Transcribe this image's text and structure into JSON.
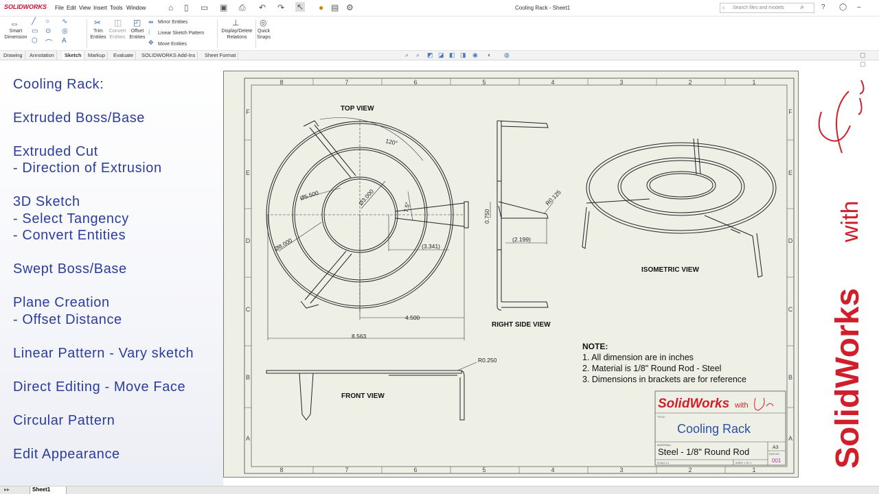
{
  "app": {
    "brand": "SOLIDWORKS",
    "window_title": "Cooling Rack - Sheet1"
  },
  "menu": [
    "File",
    "Edit",
    "View",
    "Insert",
    "Tools",
    "Window"
  ],
  "search": {
    "placeholder": "Search files and models"
  },
  "ribbon": {
    "smart_dimension": "Smart\nDimension",
    "trim_entities": "Trim\nEntities",
    "convert_entities": "Convert\nEntities",
    "offset_entities": "Offset\nEntities",
    "mirror_entities": "Mirror Entities",
    "linear_sketch_pattern": "Linear Sketch Pattern",
    "move_entities": "Move Entities",
    "display_delete_relations": "Display/Delete\nRelations",
    "quick_snaps": "Quick\nSnaps"
  },
  "tabs": [
    "Drawing",
    "Annotation",
    "Sketch",
    "Markup",
    "Evaluate",
    "SOLIDWORKS Add-Ins",
    "Sheet Format"
  ],
  "active_tab": "Sketch",
  "features": [
    "Cooling Rack:",
    "Extruded Boss/Base",
    "Extruded Cut",
    "- Direction of Extrusion",
    "3D Sketch",
    "- Select Tangency",
    "- Convert Entities",
    "Swept Boss/Base",
    "Plane Creation",
    "- Offset Distance",
    "Linear Pattern - Vary sketch",
    "Direct Editing - Move Face",
    "Circular Pattern",
    "Edit Appearance"
  ],
  "drawing": {
    "zone_cols": [
      "8",
      "7",
      "6",
      "5",
      "4",
      "3",
      "2",
      "1"
    ],
    "zone_rows": [
      "F",
      "E",
      "D",
      "C",
      "B",
      "A"
    ],
    "views": {
      "top": "TOP VIEW",
      "right": "RIGHT SIDE VIEW",
      "front": "FRONT VIEW",
      "iso": "ISOMETRIC VIEW"
    },
    "dims": {
      "angle": "120°",
      "d_5500": "Ø5.500",
      "d_3000": "Ø3.000",
      "d_8000": "Ø8.000",
      "ang75": "7.5°",
      "ref_3341": "(3.341)",
      "dim_4500": "4.500",
      "dim_8563": "8.563",
      "dim_0750": "0.750",
      "r_0125": "R0.125",
      "ref_2199": "(2.199)",
      "r_0250": "R0.250"
    },
    "note": {
      "title": "NOTE:",
      "lines": [
        "1. All dimension are in inches",
        "2. Material is 1/8\" Round Rod - Steel",
        "3. Dimensions in brackets are for reference"
      ]
    },
    "title_block": {
      "logo_main": "SolidWorks",
      "logo_with": "with",
      "title_label": "TITLE:",
      "title": "Cooling Rack",
      "material_label": "MATERIAL:",
      "material": "Steel - 1/8\" Round Rod",
      "size": "A3",
      "dwg_label": "DWG NO.",
      "dwg_no": "001",
      "scale": "SCALE:1:2",
      "sheet": "SHEET 1 OF 1"
    }
  },
  "branding": {
    "main": "SolidWorks",
    "with": "with"
  },
  "sheet_tab": "Sheet1",
  "colors": {
    "feature_text": "#2b3d9c",
    "brand_red": "#d01f2a",
    "sheet_bg": "#eef0e6"
  }
}
